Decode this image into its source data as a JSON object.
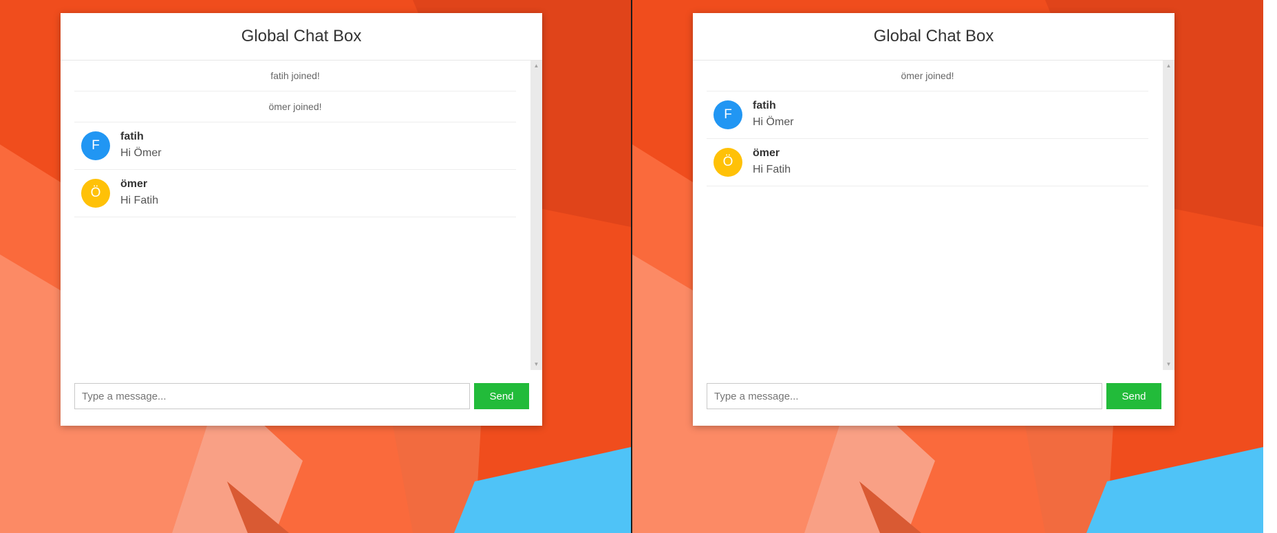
{
  "colors": {
    "avatar_blue": "#2196f3",
    "avatar_yellow": "#ffc107",
    "send_green": "#22bb3a",
    "background_orange": "#f04d1d",
    "background_blue": "#4fc3f7"
  },
  "left_window": {
    "title": "Global Chat Box",
    "system_messages": [
      "fatih joined!",
      "ömer joined!"
    ],
    "messages": [
      {
        "avatar_letter": "F",
        "avatar_color": "blue",
        "user": "fatih",
        "text": "Hi Ömer"
      },
      {
        "avatar_letter": "Ö",
        "avatar_color": "yellow",
        "user": "ömer",
        "text": "Hi Fatih"
      }
    ],
    "input_placeholder": "Type a message...",
    "send_label": "Send"
  },
  "right_window": {
    "title": "Global Chat Box",
    "system_messages": [
      "ömer joined!"
    ],
    "messages": [
      {
        "avatar_letter": "F",
        "avatar_color": "blue",
        "user": "fatih",
        "text": "Hi Ömer"
      },
      {
        "avatar_letter": "Ö",
        "avatar_color": "yellow",
        "user": "ömer",
        "text": "Hi Fatih"
      }
    ],
    "input_placeholder": "Type a message...",
    "send_label": "Send"
  }
}
